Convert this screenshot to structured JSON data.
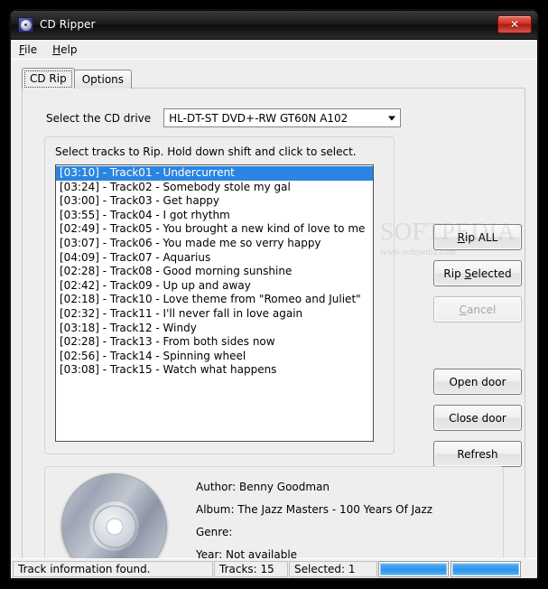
{
  "window": {
    "title": "CD Ripper",
    "icon": "cd-disc-icon",
    "close_label": "✕"
  },
  "menubar": {
    "items": [
      {
        "label": "File",
        "accel": "F"
      },
      {
        "label": "Help",
        "accel": "H"
      }
    ]
  },
  "tabs": [
    {
      "label": "CD Rip",
      "selected": true
    },
    {
      "label": "Options",
      "selected": false
    }
  ],
  "drive": {
    "label": "Select the CD drive",
    "selected": "HL-DT-ST DVD+-RW GT60N A102"
  },
  "tracks": {
    "hint": "Select tracks to Rip. Hold down shift and click to select.",
    "items": [
      {
        "text": "[03:10] - Track01 - Undercurrent",
        "selected": true
      },
      {
        "text": "[03:24] - Track02 - Somebody stole my gal",
        "selected": false
      },
      {
        "text": "[03:00] - Track03 - Get happy",
        "selected": false
      },
      {
        "text": "[03:55] - Track04 - I got rhythm",
        "selected": false
      },
      {
        "text": "[02:49] - Track05 - You brought a new kind of love to me",
        "selected": false
      },
      {
        "text": "[03:07] - Track06 - You made me so verry happy",
        "selected": false
      },
      {
        "text": "[04:09] - Track07 - Aquarius",
        "selected": false
      },
      {
        "text": "[02:28] - Track08 - Good morning sunshine",
        "selected": false
      },
      {
        "text": "[02:42] - Track09 - Up up and away",
        "selected": false
      },
      {
        "text": "[02:18] - Track10 - Love theme from \"Romeo and Juliet\"",
        "selected": false
      },
      {
        "text": "[02:32] - Track11 - I'll never fall in love again",
        "selected": false
      },
      {
        "text": "[03:18] - Track12 - Windy",
        "selected": false
      },
      {
        "text": "[02:28] - Track13 - From both sides now",
        "selected": false
      },
      {
        "text": "[02:56] - Track14 - Spinning wheel",
        "selected": false
      },
      {
        "text": "[03:08] - Track15 - Watch what happens",
        "selected": false
      }
    ]
  },
  "buttons": {
    "rip_all": {
      "pre": "R",
      "post": "ip ALL",
      "enabled": true
    },
    "rip_selected": {
      "pre": "Rip ",
      "accel": "S",
      "post": "elected",
      "enabled": true
    },
    "cancel": {
      "pre": "C",
      "post": "ancel",
      "enabled": false
    },
    "open_door": "Open door",
    "close_door": "Close door",
    "refresh": "Refresh"
  },
  "info": {
    "author": "Author: Benny Goodman",
    "album": "Album: The Jazz Masters - 100 Years Of Jazz",
    "genre": "Genre:",
    "year": "Year: Not available"
  },
  "watermark": {
    "main": "SOFTPEDIA",
    "tm": "™",
    "sub": "www.softpedia.com"
  },
  "statusbar": {
    "status": "Track information found.",
    "tracks": "Tracks: 15",
    "selected": "Selected: 1",
    "progress1_percent": 100,
    "progress2_percent": 100
  },
  "colors": {
    "selection_blue": "#2a85e0",
    "progress_blue": "#2e93ec",
    "window_bg": "#efeeee",
    "close_red": "#cf3124"
  }
}
